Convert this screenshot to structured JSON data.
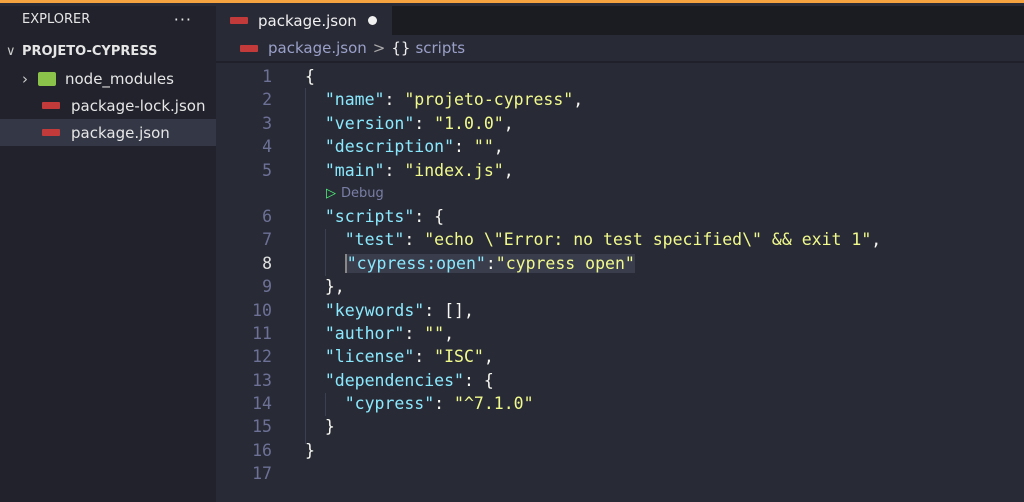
{
  "sidebar": {
    "title": "EXPLORER",
    "more": "···",
    "project": "PROJETO-CYPRESS",
    "items": [
      {
        "label": "node_modules",
        "icon": "folder-node-icon"
      },
      {
        "label": "package-lock.json",
        "icon": "npm-icon"
      },
      {
        "label": "package.json",
        "icon": "npm-icon",
        "selected": true
      }
    ]
  },
  "tab": {
    "label": "package.json",
    "modified": true
  },
  "breadcrumb": {
    "file": "package.json",
    "sep": ">",
    "braces": "{}",
    "symbol": "scripts"
  },
  "codelens": {
    "play": "▷",
    "label": "Debug"
  },
  "code": [
    {
      "n": "1",
      "seg": [
        [
          "p",
          "{"
        ]
      ]
    },
    {
      "n": "2",
      "seg": [
        [
          "p",
          "  "
        ],
        [
          "k",
          "\"name\""
        ],
        [
          "p",
          ": "
        ],
        [
          "s",
          "\"projeto-cypress\""
        ],
        [
          "p",
          ","
        ]
      ]
    },
    {
      "n": "3",
      "seg": [
        [
          "p",
          "  "
        ],
        [
          "k",
          "\"version\""
        ],
        [
          "p",
          ": "
        ],
        [
          "s",
          "\"1.0.0\""
        ],
        [
          "p",
          ","
        ]
      ]
    },
    {
      "n": "4",
      "seg": [
        [
          "p",
          "  "
        ],
        [
          "k",
          "\"description\""
        ],
        [
          "p",
          ": "
        ],
        [
          "s",
          "\"\""
        ],
        [
          "p",
          ","
        ]
      ]
    },
    {
      "n": "5",
      "seg": [
        [
          "p",
          "  "
        ],
        [
          "k",
          "\"main\""
        ],
        [
          "p",
          ": "
        ],
        [
          "s",
          "\"index.js\""
        ],
        [
          "p",
          ","
        ]
      ]
    },
    {
      "n": "6",
      "seg": [
        [
          "p",
          "  "
        ],
        [
          "k",
          "\"scripts\""
        ],
        [
          "p",
          ": {"
        ]
      ]
    },
    {
      "n": "7",
      "seg": [
        [
          "p",
          "    "
        ],
        [
          "k",
          "\"test\""
        ],
        [
          "p",
          ": "
        ],
        [
          "s",
          "\"echo \\\"Error: no test specified\\\" && exit 1\""
        ],
        [
          "p",
          ","
        ]
      ]
    },
    {
      "n": "8",
      "seg": [
        [
          "p",
          "    "
        ],
        [
          "k",
          "\"cypress:open\""
        ],
        [
          "p",
          ":"
        ],
        [
          "s",
          "\"cypress open\""
        ]
      ],
      "current": true
    },
    {
      "n": "9",
      "seg": [
        [
          "p",
          "  },"
        ]
      ]
    },
    {
      "n": "10",
      "seg": [
        [
          "p",
          "  "
        ],
        [
          "k",
          "\"keywords\""
        ],
        [
          "p",
          ": [],"
        ]
      ]
    },
    {
      "n": "11",
      "seg": [
        [
          "p",
          "  "
        ],
        [
          "k",
          "\"author\""
        ],
        [
          "p",
          ": "
        ],
        [
          "s",
          "\"\""
        ],
        [
          "p",
          ","
        ]
      ]
    },
    {
      "n": "12",
      "seg": [
        [
          "p",
          "  "
        ],
        [
          "k",
          "\"license\""
        ],
        [
          "p",
          ": "
        ],
        [
          "s",
          "\"ISC\""
        ],
        [
          "p",
          ","
        ]
      ]
    },
    {
      "n": "13",
      "seg": [
        [
          "p",
          "  "
        ],
        [
          "k",
          "\"dependencies\""
        ],
        [
          "p",
          ": {"
        ]
      ]
    },
    {
      "n": "14",
      "seg": [
        [
          "p",
          "    "
        ],
        [
          "k",
          "\"cypress\""
        ],
        [
          "p",
          ": "
        ],
        [
          "s",
          "\"^7.1.0\""
        ]
      ]
    },
    {
      "n": "15",
      "seg": [
        [
          "p",
          "  }"
        ]
      ]
    },
    {
      "n": "16",
      "seg": [
        [
          "p",
          "}"
        ]
      ]
    },
    {
      "n": "17",
      "seg": []
    }
  ]
}
